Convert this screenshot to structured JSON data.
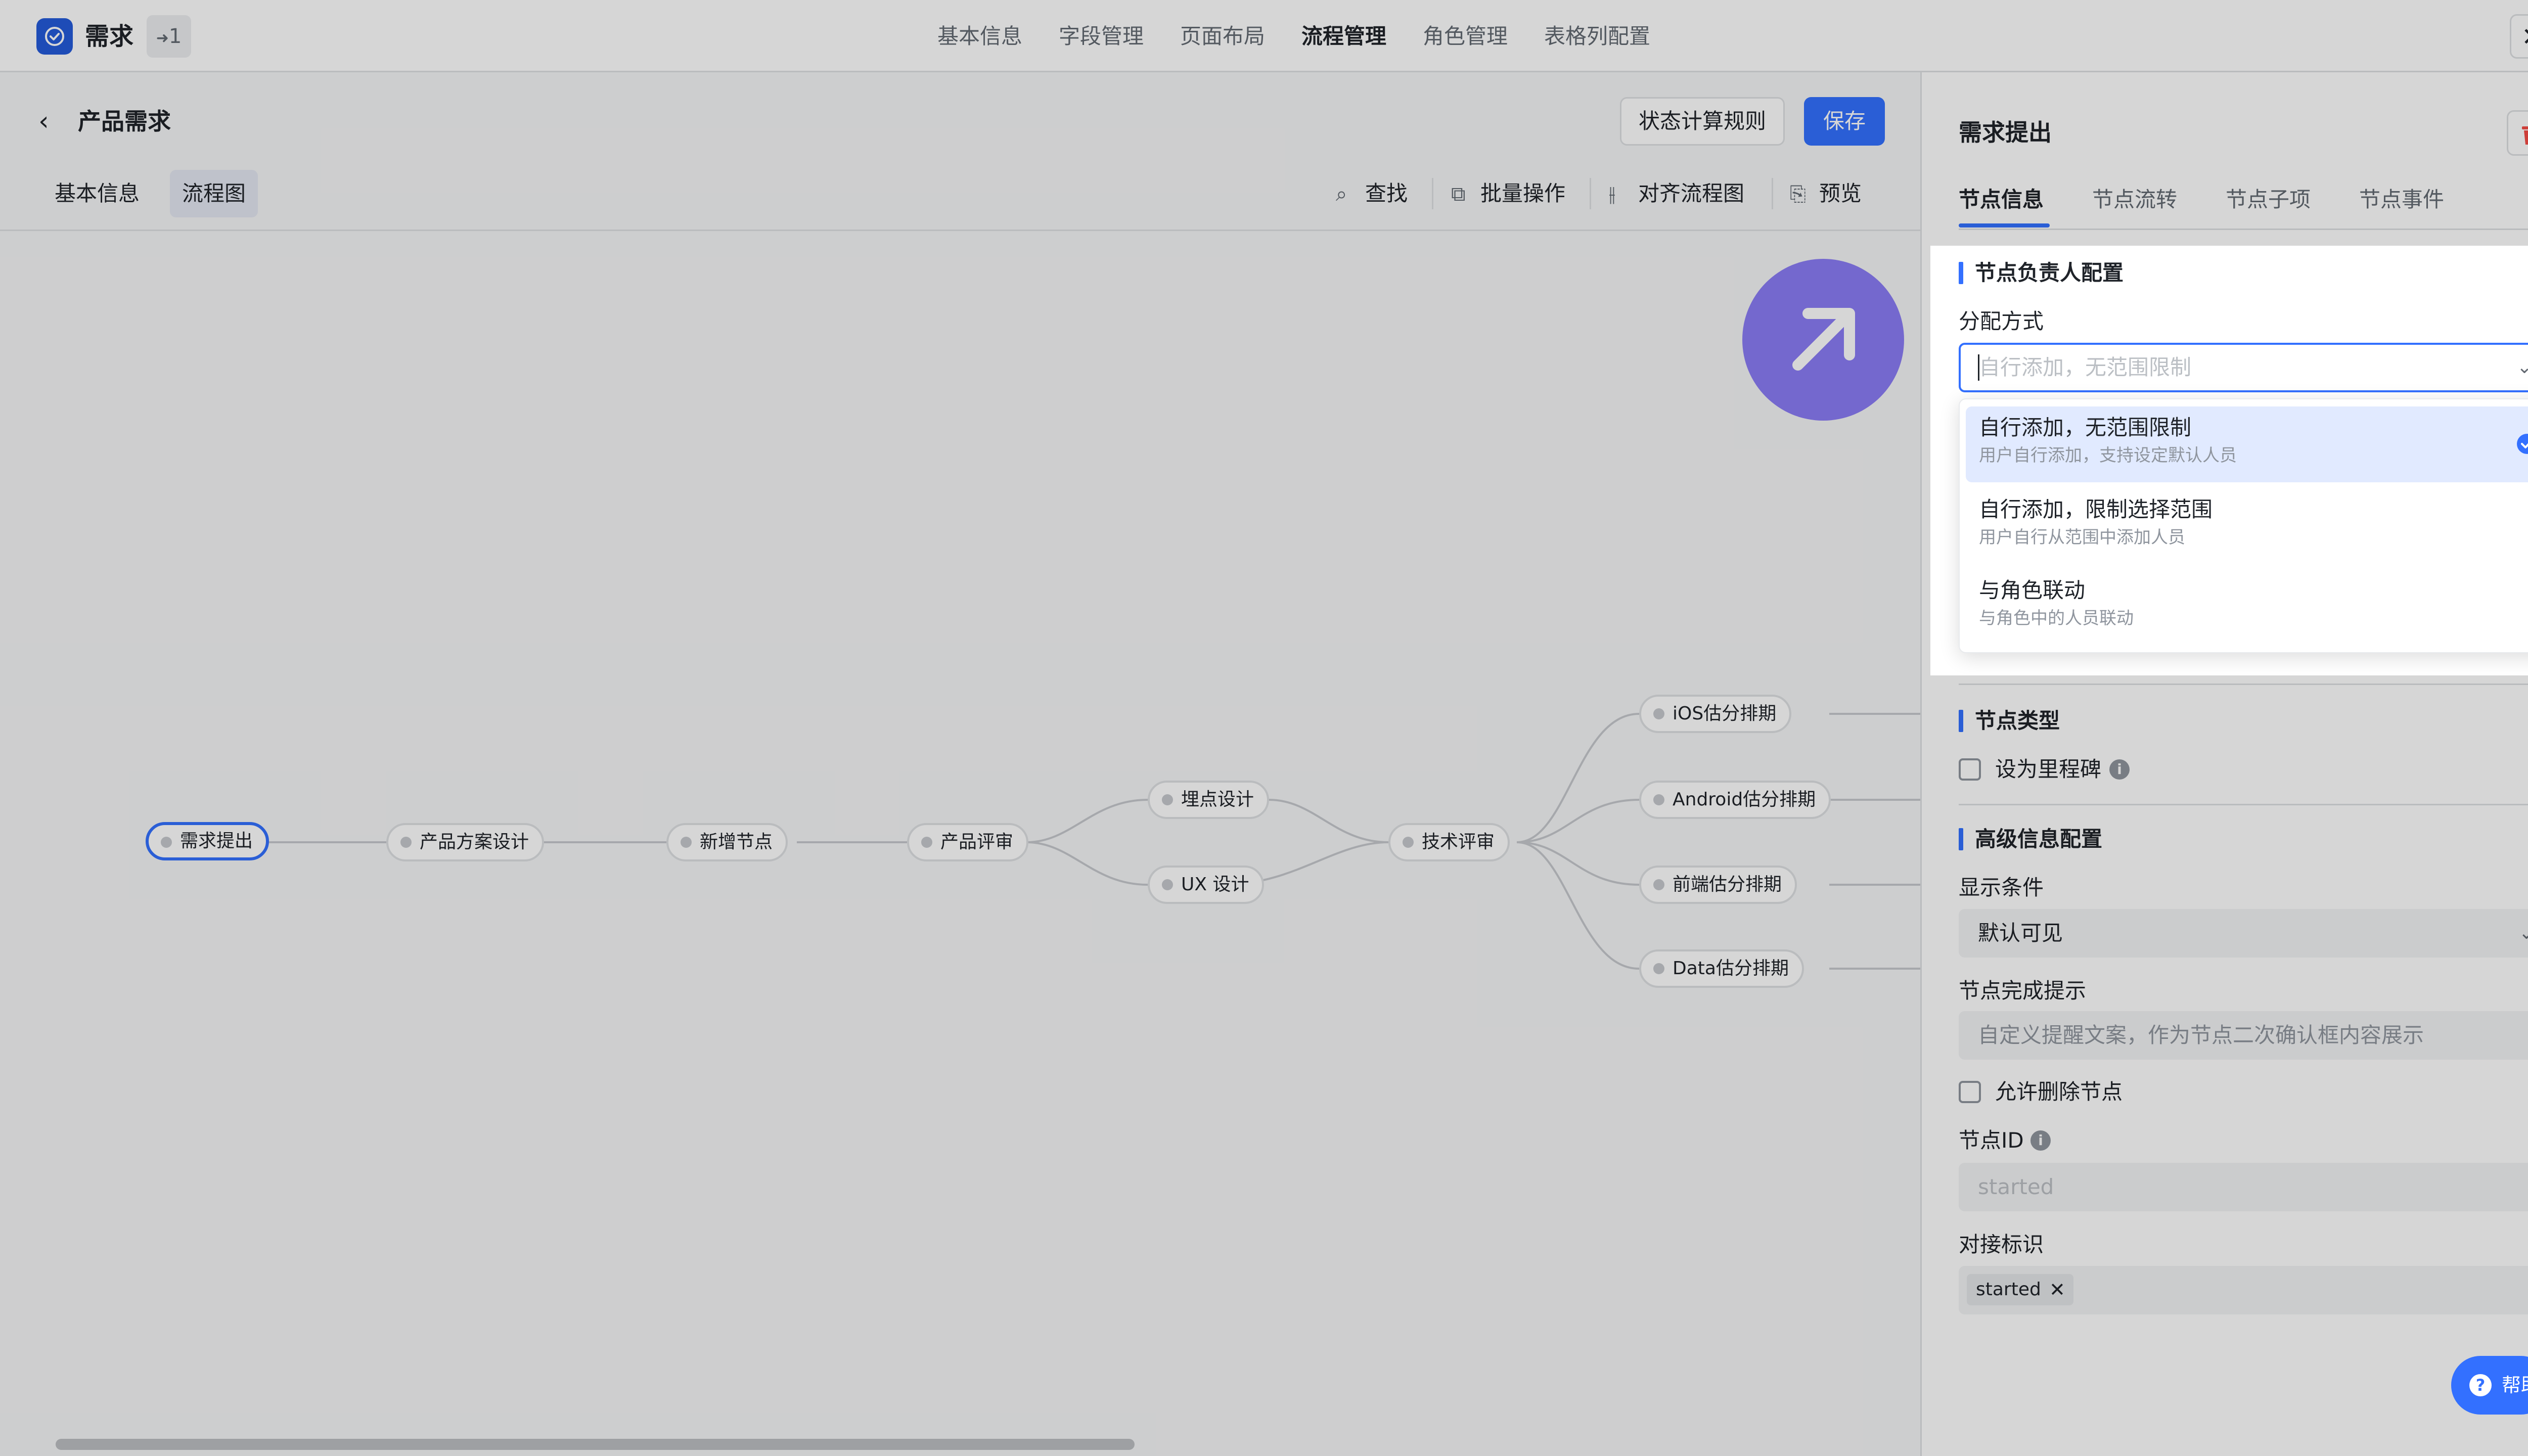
{
  "app": {
    "title": "需求",
    "version_badge": "1"
  },
  "top_tabs": [
    "基本信息",
    "字段管理",
    "页面布局",
    "流程管理",
    "角色管理",
    "表格列配置"
  ],
  "active_top_tab": "流程管理",
  "editor": {
    "flow_title": "产品需求",
    "buttons": {
      "status_rules": "状态计算规则",
      "save": "保存"
    },
    "sub_tabs": [
      "基本信息",
      "流程图"
    ],
    "active_sub_tab": "流程图",
    "tools": {
      "find": "查找",
      "batch": "批量操作",
      "align": "对齐流程图",
      "preview": "预览"
    }
  },
  "flow_nodes": {
    "start": "需求提出",
    "design": "产品方案设计",
    "new_node": "新增节点",
    "review": "产品评审",
    "tracking": "埋点设计",
    "ux": "UX 设计",
    "tech_review": "技术评审",
    "ios": "iOS估分排期",
    "android": "Android估分排期",
    "frontend": "前端估分排期",
    "data": "Data估分排期"
  },
  "panel": {
    "title": "需求提出",
    "tabs": [
      "节点信息",
      "节点流转",
      "节点子项",
      "节点事件"
    ],
    "active_tab": "节点信息",
    "owner_section": {
      "title": "节点负责人配置",
      "assign_label": "分配方式",
      "assign_placeholder": "自行添加，无范围限制",
      "options": [
        {
          "title": "自行添加，无范围限制",
          "sub": "用户自行添加，支持设定默认人员",
          "selected": true
        },
        {
          "title": "自行添加，限制选择范围",
          "sub": "用户自行从范围中添加人员",
          "selected": false
        },
        {
          "title": "与角色联动",
          "sub": "与角色中的人员联动",
          "selected": false
        }
      ]
    },
    "type_section": {
      "title": "节点类型",
      "milestone_label": "设为里程碑",
      "milestone_checked": false
    },
    "advanced_section": {
      "title": "高级信息配置",
      "display_label": "显示条件",
      "display_value": "默认可见",
      "hint_label": "节点完成提示",
      "hint_placeholder": "自定义提醒文案，作为节点二次确认框内容展示",
      "allow_delete_label": "允许删除节点",
      "allow_delete_checked": false,
      "node_id_label": "节点ID",
      "node_id_value": "started",
      "docking_label": "对接标识",
      "docking_tag": "started"
    },
    "help_label": "帮助"
  },
  "colors": {
    "primary": "#3370ff",
    "accent_purple": "#8b7cf6",
    "danger": "#f54a45"
  },
  "icons": [
    "check-icon",
    "close-icon",
    "chevron-left-icon",
    "search-icon",
    "copy-icon",
    "align-icon",
    "preview-icon",
    "arrow-up-right-icon",
    "trash-icon",
    "chevron-down-icon",
    "info-icon",
    "help-icon"
  ]
}
